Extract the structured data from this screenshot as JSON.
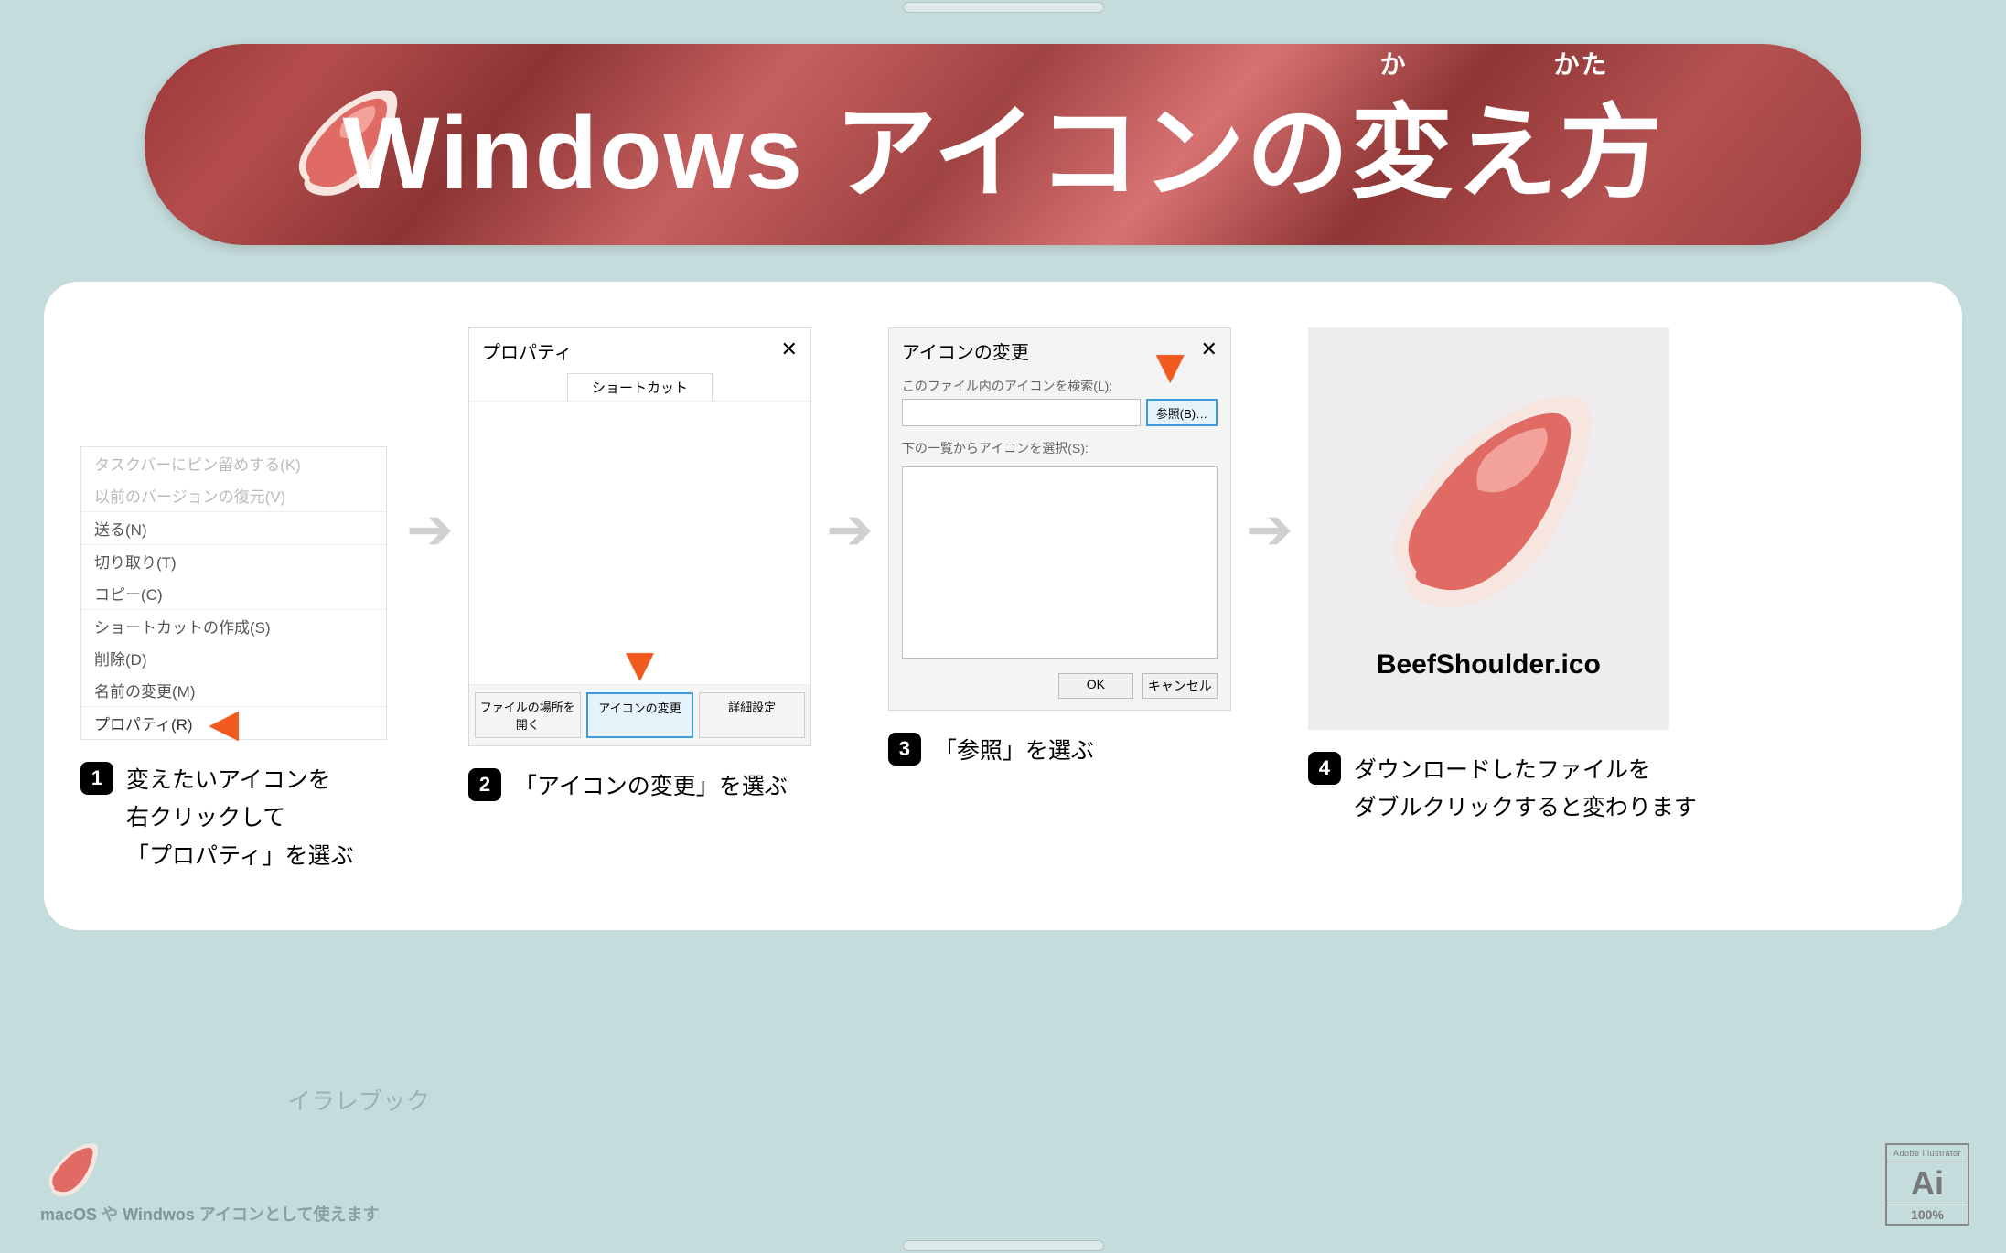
{
  "title": {
    "main": "Windows アイコンの変え方",
    "ruby_ka": "か",
    "ruby_kata": "かた"
  },
  "steps": {
    "1": {
      "num": "1",
      "desc": "変えたいアイコンを\n右クリックして\n「プロパティ」を選ぶ"
    },
    "2": {
      "num": "2",
      "desc": "「アイコンの変更」を選ぶ"
    },
    "3": {
      "num": "3",
      "desc": "「参照」を選ぶ"
    },
    "4": {
      "num": "4",
      "desc": "ダウンロードしたファイルを\nダブルクリックすると変わります"
    }
  },
  "context_menu": {
    "items_faded": [
      "タスクバーにピン留めする(K)",
      "以前のバージョンの復元(V)"
    ],
    "send": "送る(N)",
    "cut": "切り取り(T)",
    "copy": "コピー(C)",
    "shortcut": "ショートカットの作成(S)",
    "delete": "削除(D)",
    "rename": "名前の変更(M)",
    "properties": "プロパティ(R)"
  },
  "props_dialog": {
    "title": "プロパティ",
    "tab": "ショートカット",
    "btn_open": "ファイルの場所を開く",
    "btn_change": "アイコンの変更",
    "btn_adv": "詳細設定"
  },
  "change_dialog": {
    "title": "アイコンの変更",
    "label_search": "このファイル内のアイコンを検索(L):",
    "btn_browse": "参照(B)…",
    "label_list": "下の一覧からアイコンを選択(S):",
    "btn_ok": "OK",
    "btn_cancel": "キャンセル"
  },
  "result": {
    "filename": "BeefShoulder.ico"
  },
  "footer": {
    "brand": "イラレブック",
    "note_prefix": "macOS",
    "note_mid": " や ",
    "note_win": "Windwos",
    "note_suffix": " アイコンとして使えます"
  },
  "ai_badge": {
    "top": "Adobe Illustrator",
    "mid": "Ai",
    "bot": "100%"
  }
}
